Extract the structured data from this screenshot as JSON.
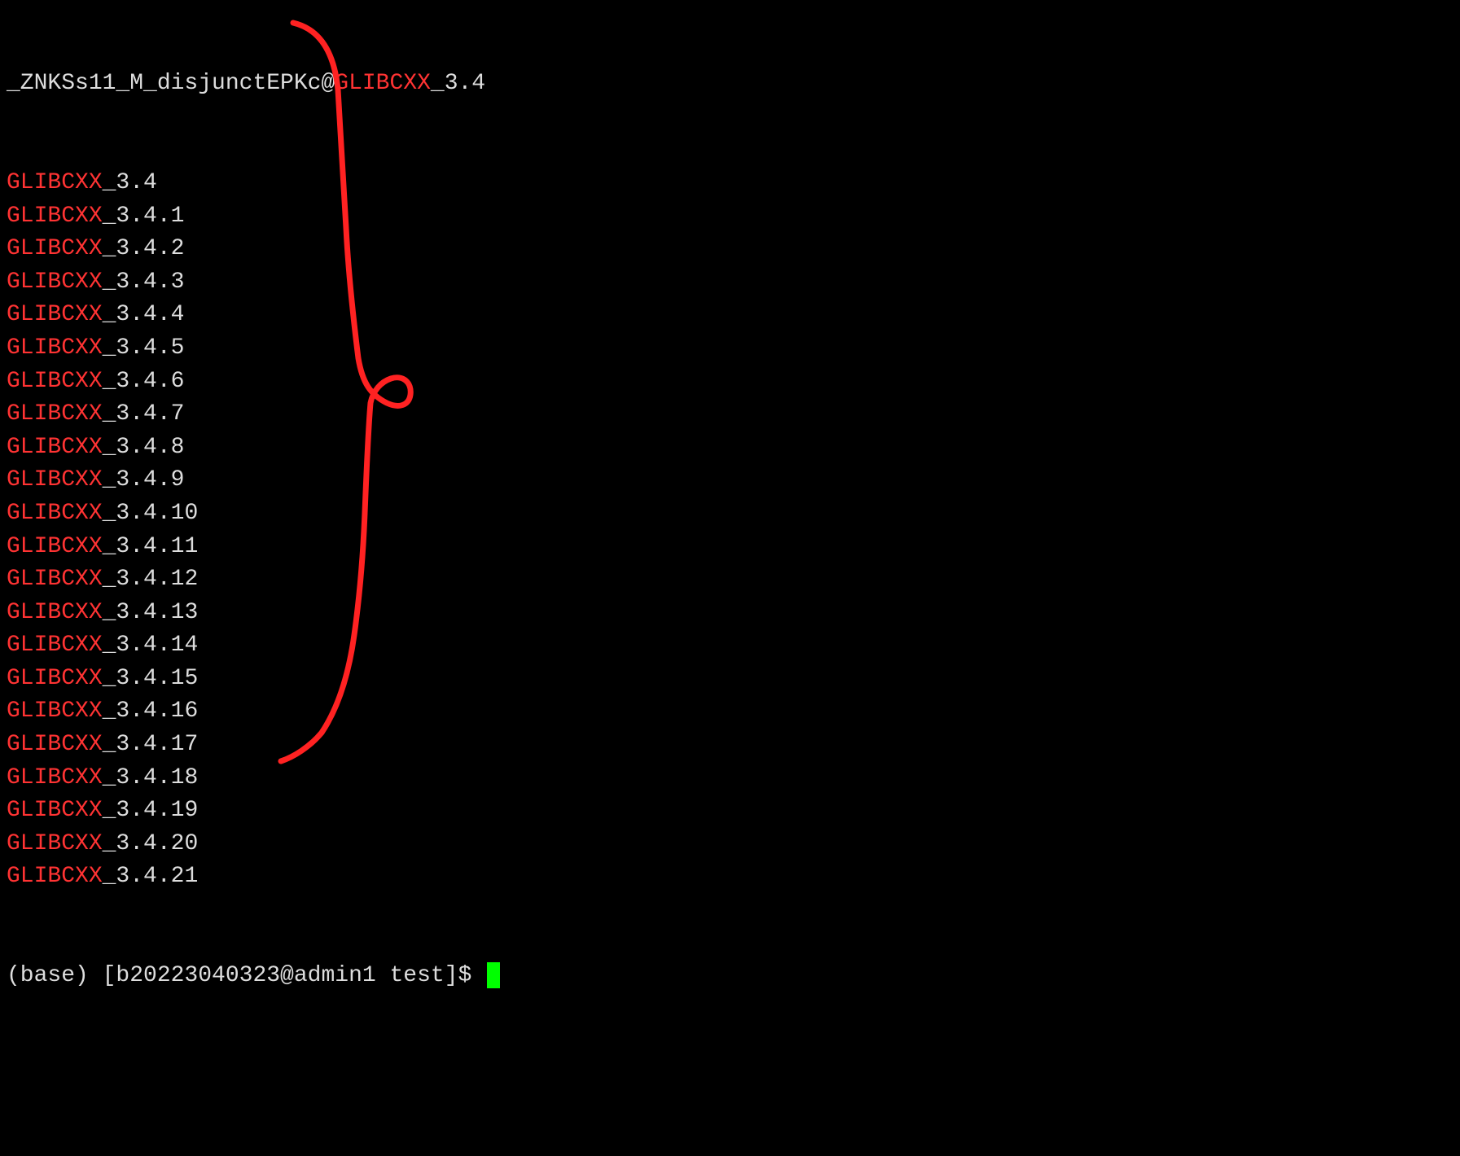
{
  "first_line": {
    "prefix": "_ZNKSs11_M_disjunctEPKc@",
    "highlight": "GLIBCXX",
    "suffix": "_3.4"
  },
  "lines": [
    {
      "highlight": "GLIBCXX",
      "suffix": "_3.4"
    },
    {
      "highlight": "GLIBCXX",
      "suffix": "_3.4.1"
    },
    {
      "highlight": "GLIBCXX",
      "suffix": "_3.4.2"
    },
    {
      "highlight": "GLIBCXX",
      "suffix": "_3.4.3"
    },
    {
      "highlight": "GLIBCXX",
      "suffix": "_3.4.4"
    },
    {
      "highlight": "GLIBCXX",
      "suffix": "_3.4.5"
    },
    {
      "highlight": "GLIBCXX",
      "suffix": "_3.4.6"
    },
    {
      "highlight": "GLIBCXX",
      "suffix": "_3.4.7"
    },
    {
      "highlight": "GLIBCXX",
      "suffix": "_3.4.8"
    },
    {
      "highlight": "GLIBCXX",
      "suffix": "_3.4.9"
    },
    {
      "highlight": "GLIBCXX",
      "suffix": "_3.4.10"
    },
    {
      "highlight": "GLIBCXX",
      "suffix": "_3.4.11"
    },
    {
      "highlight": "GLIBCXX",
      "suffix": "_3.4.12"
    },
    {
      "highlight": "GLIBCXX",
      "suffix": "_3.4.13"
    },
    {
      "highlight": "GLIBCXX",
      "suffix": "_3.4.14"
    },
    {
      "highlight": "GLIBCXX",
      "suffix": "_3.4.15"
    },
    {
      "highlight": "GLIBCXX",
      "suffix": "_3.4.16"
    },
    {
      "highlight": "GLIBCXX",
      "suffix": "_3.4.17"
    },
    {
      "highlight": "GLIBCXX",
      "suffix": "_3.4.18"
    },
    {
      "highlight": "GLIBCXX",
      "suffix": "_3.4.19"
    },
    {
      "highlight": "GLIBCXX",
      "suffix": "_3.4.20"
    },
    {
      "highlight": "GLIBCXX",
      "suffix": "_3.4.21"
    }
  ],
  "prompt": {
    "text": "(base) [b20223040323@admin1 test]$ "
  }
}
